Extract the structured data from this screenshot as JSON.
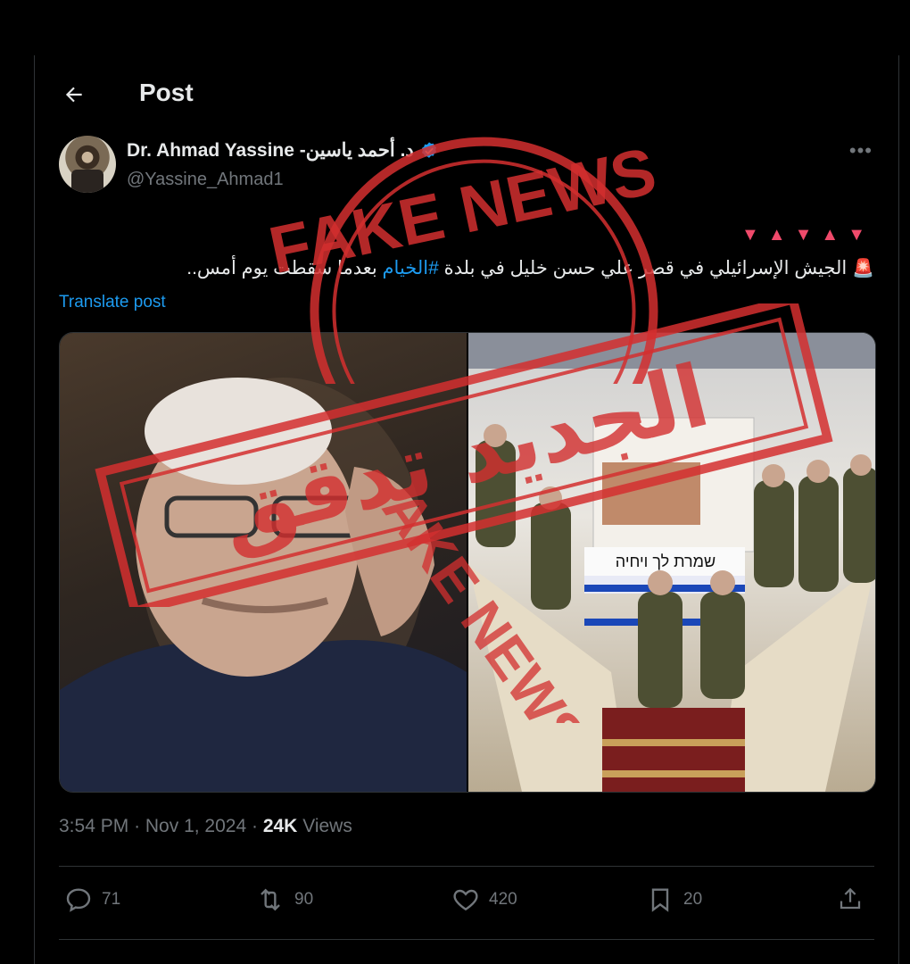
{
  "header": {
    "title": "Post"
  },
  "author": {
    "display_name": "Dr. Ahmad Yassine -د. أحمد ياسين",
    "handle": "@Yassine_Ahmad1",
    "verified": true
  },
  "tweet": {
    "decoration": "▼▲▼▲▼",
    "text_before": "الجيش الإسرائيلي في قصر علي حسن خليل في بلدة ",
    "hashtag": "#الخيام",
    "text_after": " بعدما سقطت يوم أمس..",
    "translate_label": "Translate post"
  },
  "media": {
    "banner_text": "שמרת לך ויחיה"
  },
  "meta": {
    "time": "3:54 PM",
    "date": "Nov 1, 2024",
    "views_count": "24K",
    "views_label": "Views"
  },
  "actions": {
    "replies": "71",
    "reposts": "90",
    "likes": "420",
    "bookmarks": "20"
  },
  "stamps": {
    "top_text": "FAKE NEWS",
    "arabic_text": "الجديد تدقق",
    "bottom_text": "FAKE NEWS"
  },
  "colors": {
    "stamp": "#d32f2f",
    "link": "#1d9bf0",
    "muted": "#71767b",
    "accent_pink": "#f04a6b"
  },
  "icons": [
    "back-arrow-icon",
    "verified-badge-icon",
    "more-icon",
    "alarm-icon",
    "reply-icon",
    "repost-icon",
    "like-icon",
    "bookmark-icon",
    "share-icon"
  ]
}
